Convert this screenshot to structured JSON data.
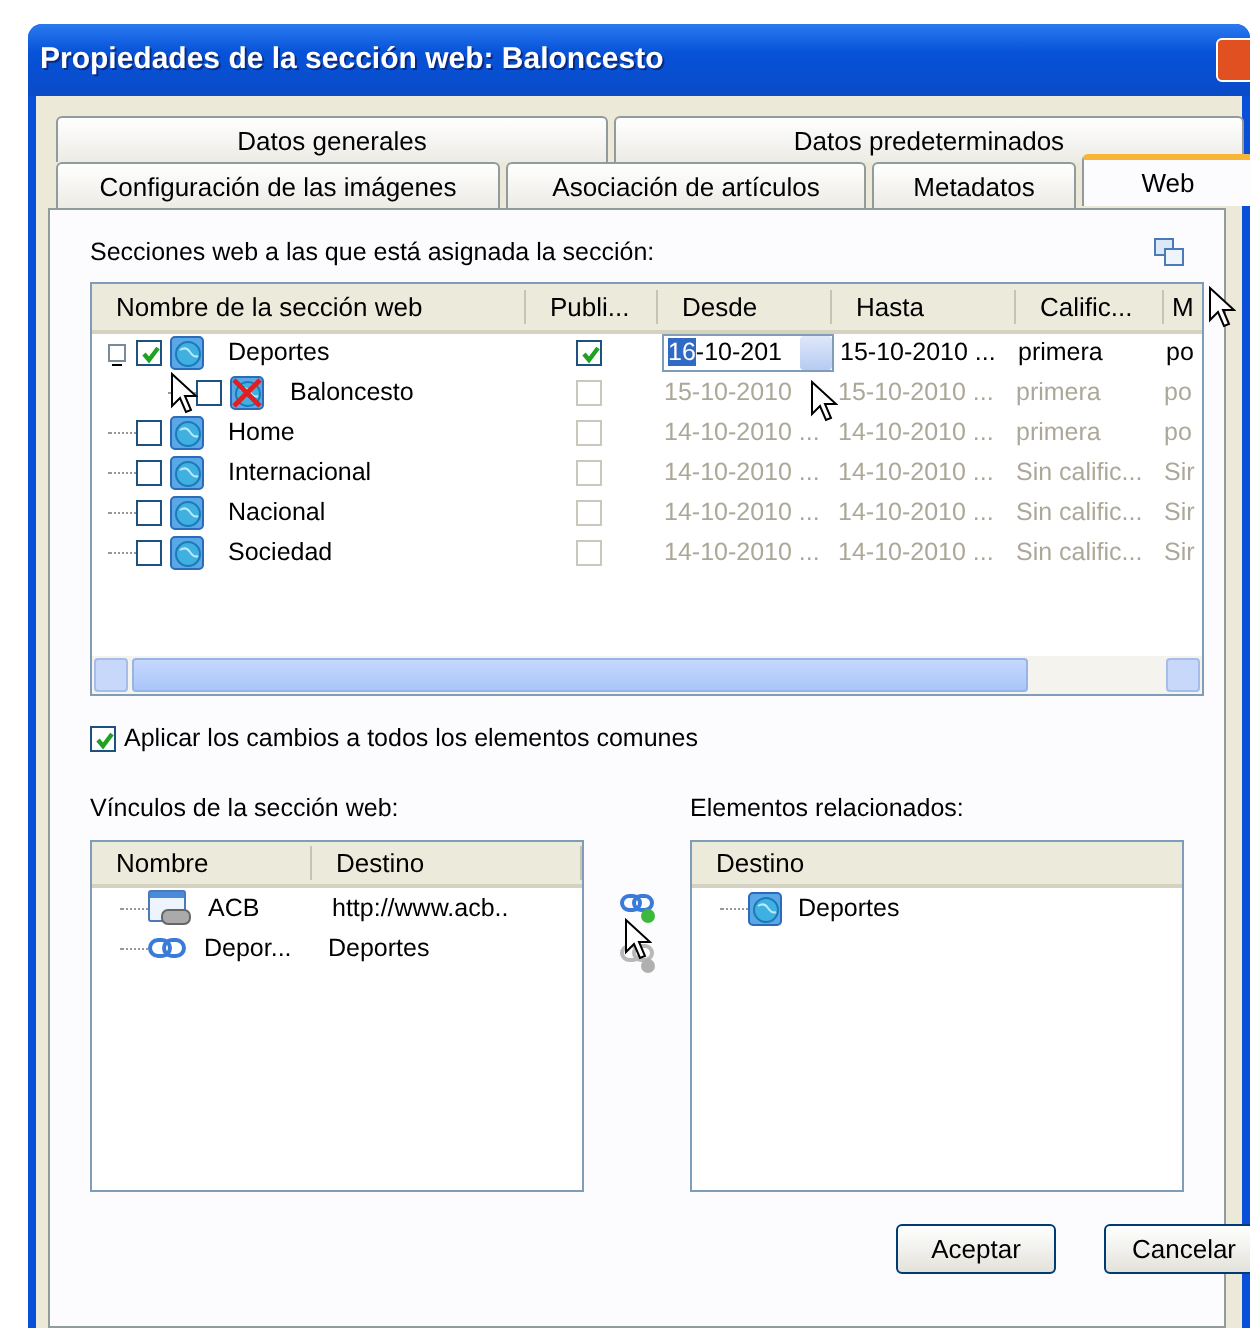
{
  "window": {
    "title": "Propiedades de la sección web: Baloncesto"
  },
  "tabs": [
    [
      {
        "label": "Datos generales",
        "selected": false
      },
      {
        "label": "Datos predeterminados",
        "selected": false
      }
    ],
    [
      {
        "label": "Configuración de las imágenes",
        "selected": false
      },
      {
        "label": "Asociación de artículos",
        "selected": false
      },
      {
        "label": "Metadatos",
        "selected": false
      },
      {
        "label": "Web",
        "selected": true
      }
    ]
  ],
  "sections": {
    "label": "Secciones web a las que está asignada la sección:",
    "columns": [
      "Nombre de la sección web",
      "Publi...",
      "Desde",
      "Hasta",
      "Calific...",
      "M"
    ],
    "rows": [
      {
        "name": "Deportes",
        "checked": true,
        "kind": "web",
        "expanded": true,
        "published": true,
        "disabled": false,
        "editing": true,
        "desde_selected": "16",
        "desde": "-10-201",
        "hasta": "15-10-2010 ...",
        "calific": "primera",
        "column_6": "po",
        "children": [
          {
            "name": "Baloncesto",
            "checked": false,
            "kind": "blocked",
            "published": false,
            "disabled": true,
            "editing": false,
            "desde": "15-10-2010",
            "hasta": "15-10-2010 ...",
            "calific": "primera",
            "column_6": "po"
          }
        ]
      },
      {
        "name": "Home",
        "checked": false,
        "kind": "web",
        "published": false,
        "disabled": true,
        "editing": false,
        "desde": "14-10-2010 ...",
        "hasta": "14-10-2010 ...",
        "calific": "primera",
        "column_6": "po"
      },
      {
        "name": "Internacional",
        "checked": false,
        "kind": "web",
        "published": false,
        "disabled": true,
        "editing": false,
        "desde": "14-10-2010 ...",
        "hasta": "14-10-2010 ...",
        "calific": "Sin calific...",
        "column_6": "Sir"
      },
      {
        "name": "Nacional",
        "checked": false,
        "kind": "web",
        "published": false,
        "disabled": true,
        "editing": false,
        "desde": "14-10-2010 ...",
        "hasta": "14-10-2010 ...",
        "calific": "Sin calific...",
        "column_6": "Sir"
      },
      {
        "name": "Sociedad",
        "checked": false,
        "kind": "web",
        "published": false,
        "disabled": true,
        "editing": false,
        "desde": "14-10-2010 ...",
        "hasta": "14-10-2010 ...",
        "calific": "Sin calific...",
        "column_6": "Sir"
      }
    ]
  },
  "apply_common": {
    "label": "Aplicar los cambios a todos los elementos comunes",
    "checked": true
  },
  "links": {
    "label": "Vínculos de la sección web:",
    "columns": [
      "Nombre",
      "Destino"
    ],
    "rows": [
      {
        "kind": "url",
        "name": "ACB",
        "destino": "http://www.acb.."
      },
      {
        "kind": "section",
        "name": "Depor...",
        "destino": "Deportes"
      }
    ]
  },
  "link_actions": [
    {
      "kind": "add",
      "disabled": false
    },
    {
      "kind": "remove",
      "disabled": true
    }
  ],
  "related": {
    "label": "Elementos relacionados:",
    "columns": [
      "Destino"
    ],
    "rows": [
      {
        "kind": "web",
        "name": "Deportes"
      }
    ]
  },
  "buttons": [
    "Aceptar",
    "Cancelar"
  ]
}
